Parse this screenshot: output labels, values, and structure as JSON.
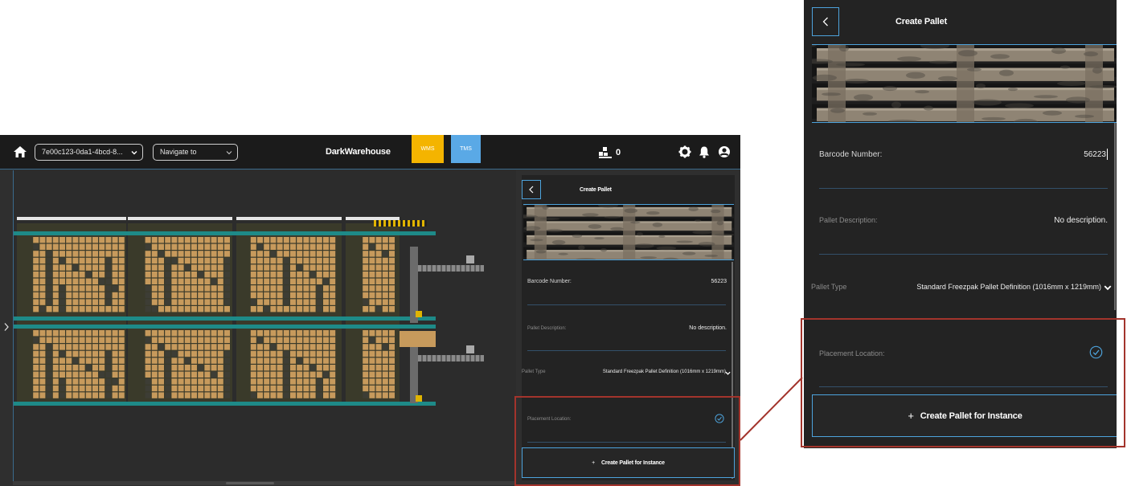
{
  "topbar": {
    "warehouse_select": "7e00c123-0da1-4bcd-8...",
    "navigate_select": "Navigate to",
    "brand": "DarkWarehouse",
    "wms_tab": "WMS",
    "tms_tab": "TMS",
    "pallet_count": "0"
  },
  "panel": {
    "title": "Create Pallet",
    "barcode_label": "Barcode Number:",
    "barcode_value": "56223",
    "description_label": "Pallet Description:",
    "description_value": "No description.",
    "type_label": "Pallet Type",
    "type_value": "Standard Freezpak Pallet Definition (1016mm x 1219mm)",
    "placement_label": "Placement Location:",
    "create_button": "Create Pallet for Instance"
  },
  "colors": {
    "accent_blue": "#4da3dc",
    "wms_yellow": "#f4b400",
    "tms_blue": "#5aa9e6",
    "highlight_red": "#a3342c",
    "rack_tan": "#c79a5c"
  },
  "icons": [
    "home-icon",
    "chevron-down-icon",
    "pallet-stack-icon",
    "gear-icon",
    "bell-icon",
    "user-icon",
    "back-arrow-icon",
    "checkmark-circle-icon",
    "plus-icon",
    "expand-arrow-icon"
  ]
}
